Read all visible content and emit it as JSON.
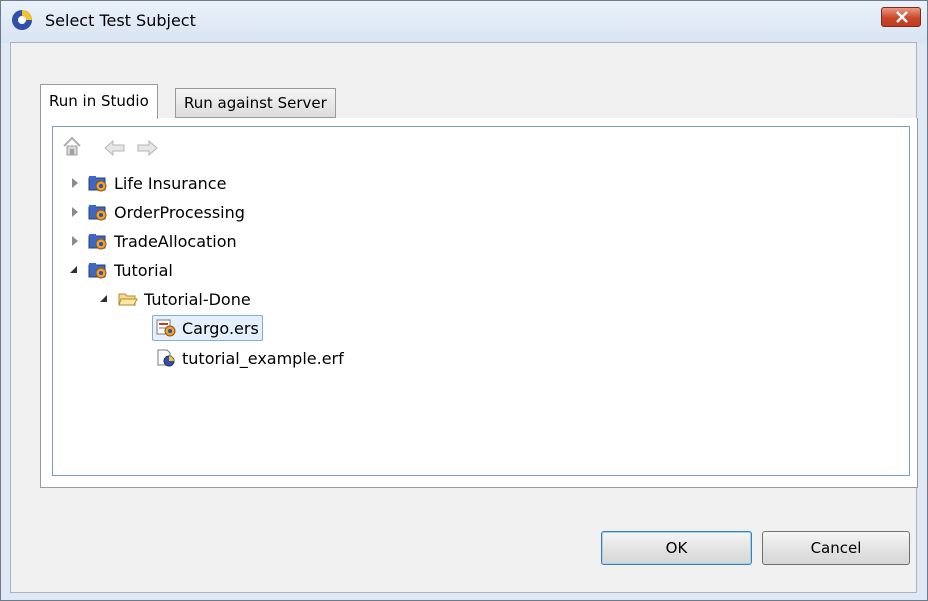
{
  "window": {
    "title": "Select Test Subject"
  },
  "tabs": [
    {
      "label": "Run in Studio"
    },
    {
      "label": "Run against Server"
    }
  ],
  "tree": {
    "items": [
      {
        "label": "Life Insurance"
      },
      {
        "label": "OrderProcessing"
      },
      {
        "label": "TradeAllocation"
      },
      {
        "label": "Tutorial"
      },
      {
        "label": "Tutorial-Done"
      },
      {
        "label": "Cargo.ers"
      },
      {
        "label": "tutorial_example.erf"
      }
    ]
  },
  "buttons": {
    "ok": "OK",
    "cancel": "Cancel"
  }
}
